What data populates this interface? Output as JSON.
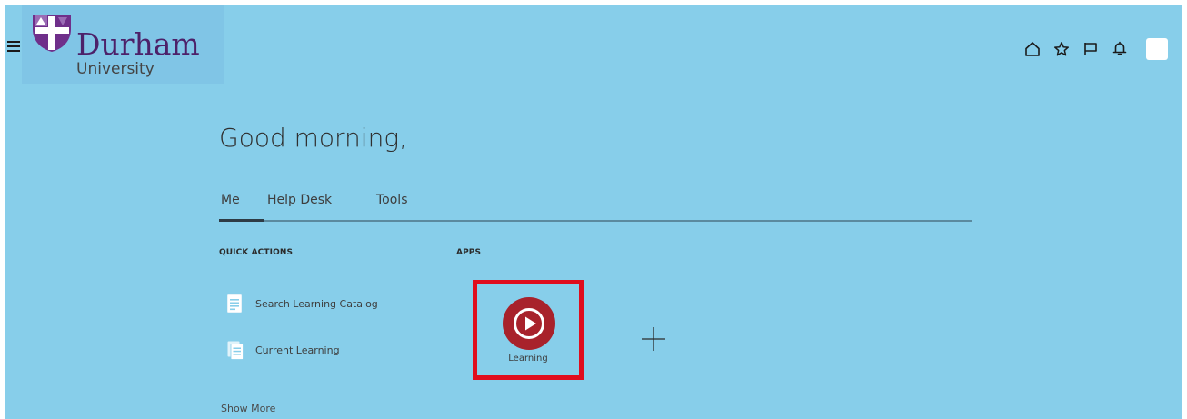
{
  "header": {
    "logo": {
      "name": "Durham",
      "subtitle": "University"
    },
    "icons": [
      "menu-icon",
      "home-icon",
      "star-icon",
      "flag-icon",
      "bell-icon",
      "avatar"
    ]
  },
  "greeting": "Good morning,",
  "tabs": [
    {
      "label": "Me",
      "selected": true
    },
    {
      "label": "Help Desk",
      "selected": false
    },
    {
      "label": "Tools",
      "selected": false
    }
  ],
  "quick_actions": {
    "heading": "QUICK ACTIONS",
    "items": [
      {
        "label": "Search Learning Catalog",
        "icon": "document-icon"
      },
      {
        "label": "Current Learning",
        "icon": "documents-icon"
      }
    ],
    "show_more": "Show More"
  },
  "apps": {
    "heading": "APPS",
    "items": [
      {
        "label": "Learning",
        "icon": "play-icon",
        "highlighted": true
      }
    ],
    "add_icon": "plus-icon"
  },
  "colors": {
    "background": "#87ceea",
    "brand_purple": "#4c2169",
    "learning_app": "#a8222b",
    "highlight_border": "#e00d1d"
  }
}
